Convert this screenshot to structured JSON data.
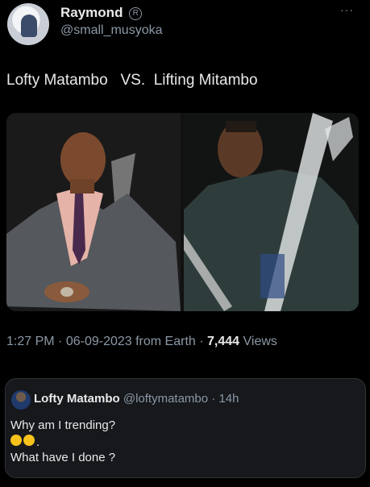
{
  "tweet": {
    "display_name": "Raymond",
    "badge": "R",
    "handle": "@small_musyoka",
    "more": "···",
    "text": "Lofty Matambo   VS.  Lifting Mitambo",
    "meta": {
      "time": "1:27 PM",
      "sep1": " · ",
      "date": "06-09-2023",
      "source": " from Earth",
      "sep2": " · ",
      "views_count": "7,444",
      "views_label": " Views"
    }
  },
  "quote": {
    "display_name": "Lofty Matambo",
    "handle": "@loftymatambo",
    "sep": " · ",
    "age": "14h",
    "line1": "Why am I trending?",
    "line2_suffix": ".",
    "line3": "What have I done ?"
  },
  "colors": {
    "background": "#000000",
    "text": "#e7e9ea",
    "secondary": "#8b98a5",
    "quote_bg": "#16181c"
  }
}
